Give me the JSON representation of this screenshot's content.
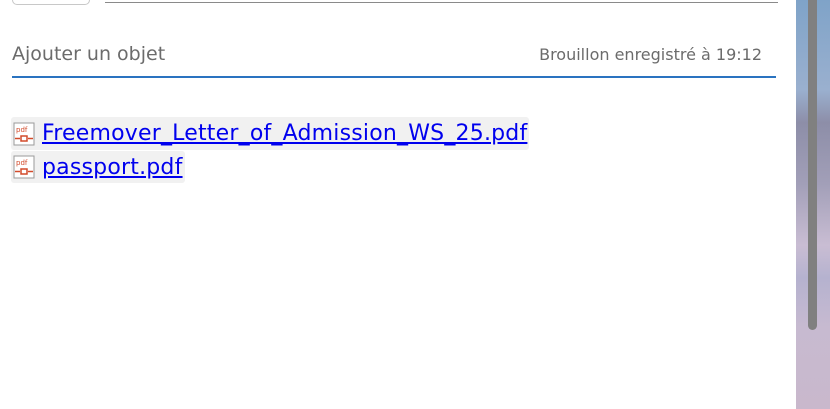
{
  "compose": {
    "subject_placeholder": "Ajouter un objet",
    "draft_status": "Brouillon enregistré à 19:12"
  },
  "attachments": [
    {
      "name": "Freemover_Letter_of_Admission_WS_25.pdf",
      "icon": "pdf-file-icon"
    },
    {
      "name": "passport.pdf",
      "icon": "pdf-file-icon"
    }
  ],
  "colors": {
    "accent": "#2a73c0",
    "link": "#0000ee"
  }
}
